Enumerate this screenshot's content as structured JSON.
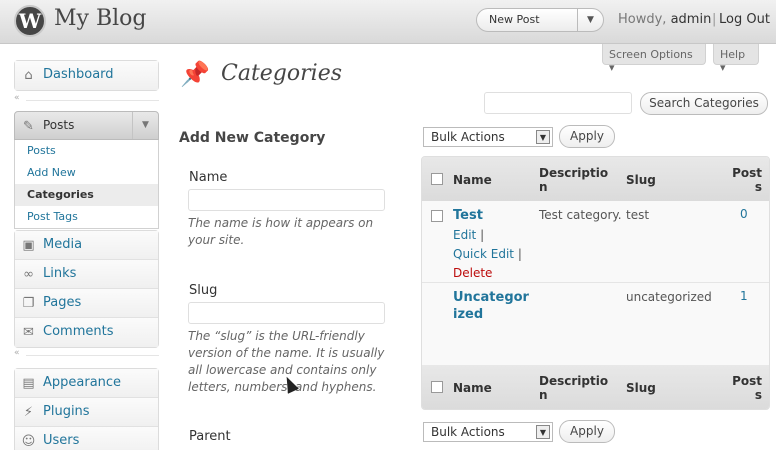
{
  "header": {
    "site_title": "My Blog",
    "new_post_label": "New Post",
    "howdy_prefix": "Howdy,",
    "user": "admin",
    "logout_label": "Log Out"
  },
  "tabs": {
    "screen_options": "Screen Options",
    "help": "Help"
  },
  "sidebar": {
    "dashboard": "Dashboard",
    "posts": "Posts",
    "posts_submenu": [
      "Posts",
      "Add New",
      "Categories",
      "Post Tags"
    ],
    "items": [
      "Media",
      "Links",
      "Pages",
      "Comments"
    ],
    "items2": [
      "Appearance",
      "Plugins",
      "Users"
    ]
  },
  "main": {
    "title": "Categories",
    "search_button": "Search Categories",
    "search_value": "",
    "bulk_actions": "Bulk Actions",
    "apply": "Apply"
  },
  "form": {
    "heading": "Add New Category",
    "name_label": "Name",
    "name_value": "",
    "name_desc": "The name is how it appears on your site.",
    "slug_label": "Slug",
    "slug_value": "",
    "slug_desc": "The “slug” is the URL-friendly version of the name. It is usually all lowercase and contains only letters, numbers, and hyphens.",
    "parent_label": "Parent"
  },
  "table": {
    "columns": [
      "Name",
      "Description",
      "Slug",
      "Posts"
    ],
    "rows": [
      {
        "name": "Test",
        "description": "Test category.",
        "slug": "test",
        "posts": "0",
        "actions": [
          "Edit",
          "Quick Edit",
          "Delete"
        ]
      },
      {
        "name": "Uncategorized",
        "description": "",
        "slug": "uncategorized",
        "posts": "1"
      }
    ]
  }
}
